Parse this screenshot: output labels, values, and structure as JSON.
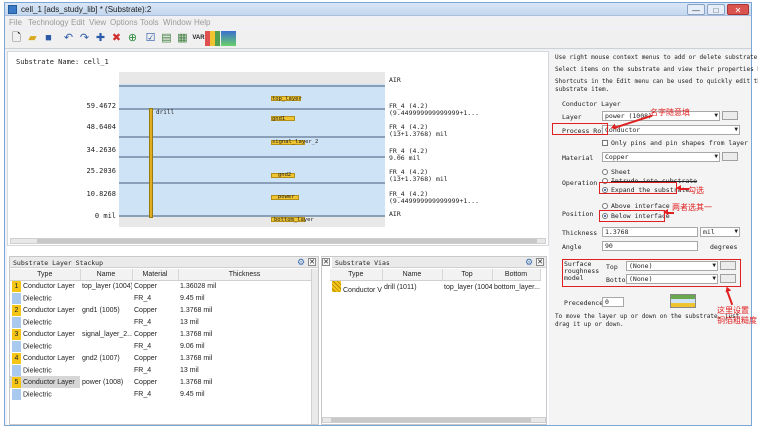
{
  "window": {
    "title": "cell_1 [ads_study_lib] * (Substrate):2",
    "controls": [
      "—",
      "□",
      "✕"
    ]
  },
  "menu": [
    "File",
    "Technology",
    "Edit",
    "View",
    "Options",
    "Tools",
    "Window",
    "Help"
  ],
  "toolbar": {
    "icons": [
      "new-icon",
      "open-icon",
      "save-icon",
      "undo-icon",
      "redo-icon",
      "insert-icon",
      "delete-icon",
      "zoom-icon",
      "check-icon",
      "table-icon",
      "table-icon",
      "var-icon",
      "layers-icon",
      "color-icon"
    ],
    "var_label": "VAR"
  },
  "substrate": {
    "name_label": "Substrate Name:",
    "name_value": "cell_1",
    "air_top": "AIR",
    "air_bottom": "AIR",
    "y_labels": [
      "59.4672",
      "48.6404",
      "34.2636",
      "25.2036",
      "10.8268",
      "0 mil"
    ],
    "right_labels": [
      "FR_4 (4.2)\n(9.449999999999999+1...",
      "FR_4 (4.2)\n(13+1.3768) mil",
      "FR_4 (4.2)\n9.06 mil",
      "FR_4 (4.2)\n(13+1.3768) mil",
      "FR_4 (4.2)\n(9.449999999999999+1..."
    ],
    "conductors": [
      "top_layer",
      "gnd1",
      "signal_layer_2",
      "gnd2",
      "power",
      "bottom_layer"
    ],
    "via_label": "drill"
  },
  "layer_stackup": {
    "title": "Substrate Layer Stackup",
    "columns": [
      "Type",
      "Name",
      "Material",
      "Thickness"
    ],
    "rows": [
      {
        "idx": "1",
        "type": "Conductor Layer",
        "name": "top_layer (1004)",
        "material": "Copper",
        "thickness": "1.36028 mil"
      },
      {
        "idx": "",
        "type": "Dielectric",
        "name": "",
        "material": "FR_4",
        "thickness": "9.45 mil"
      },
      {
        "idx": "2",
        "type": "Conductor Layer",
        "name": "gnd1 (1005)",
        "material": "Copper",
        "thickness": "1.3768 mil"
      },
      {
        "idx": "",
        "type": "Dielectric",
        "name": "",
        "material": "FR_4",
        "thickness": "13 mil"
      },
      {
        "idx": "3",
        "type": "Conductor Layer",
        "name": "signal_layer_2...",
        "material": "Copper",
        "thickness": "1.3768 mil"
      },
      {
        "idx": "",
        "type": "Dielectric",
        "name": "",
        "material": "FR_4",
        "thickness": "9.06 mil"
      },
      {
        "idx": "4",
        "type": "Conductor Layer",
        "name": "gnd2 (1007)",
        "material": "Copper",
        "thickness": "1.3768 mil"
      },
      {
        "idx": "",
        "type": "Dielectric",
        "name": "",
        "material": "FR_4",
        "thickness": "13 mil"
      },
      {
        "idx": "5",
        "type": "Conductor Layer",
        "name": "power (1008)",
        "material": "Copper",
        "thickness": "1.3768 mil"
      },
      {
        "idx": "",
        "type": "Dielectric",
        "name": "",
        "material": "FR_4",
        "thickness": "9.45 mil"
      }
    ]
  },
  "vias": {
    "title": "Substrate Vias",
    "columns": [
      "Type",
      "Name",
      "Top",
      "Bottom"
    ],
    "rows": [
      {
        "type": "Conductor Via",
        "name": "drill (1011)",
        "top": "top_layer (1004)",
        "bottom": "bottom_layer..."
      }
    ]
  },
  "properties": {
    "help": [
      "Use right mouse context menus to add or delete substrate items.",
      "Select items on the substrate and view their properties below.",
      "Shortcuts in the Edit menu can be used to quickly edit the next",
      "substrate item."
    ],
    "section": "Conductor Layer",
    "layer_label": "Layer",
    "layer_value": "power (1008)",
    "process_role_label": "Process Role",
    "process_role_value": "Conductor",
    "only_pins_label": "Only pins and pin shapes from layer",
    "material_label": "Material",
    "material_value": "Copper",
    "operation_label": "Operation",
    "op_sheet": "Sheet",
    "op_intrude": "Intrude into substrate",
    "op_expand": "Expand the substrate",
    "position_label": "Position",
    "pos_above": "Above interface",
    "pos_below": "Below interface",
    "thickness_label": "Thickness",
    "thickness_value": "1.3768",
    "thickness_unit": "mil",
    "angle_label": "Angle",
    "angle_value": "90",
    "angle_unit": "degrees",
    "roughness_label": "Surface roughness model",
    "rough_top_label": "Top",
    "rough_top_value": "(None)",
    "rough_bottom_label": "Bottom",
    "rough_bottom_value": "(None)",
    "precedence_label": "Precedence",
    "precedence_value": "0",
    "move_help": "To move the layer up or down on the substrate, just drag it up or down."
  },
  "annotations": {
    "name_note": "名字随意填",
    "expand_note": "勾选",
    "position_note": "两者选其一",
    "roughness_note_1": "这里设置",
    "roughness_note_2": "铜箔粗糙度"
  },
  "colors": {
    "annotation": "#e02020",
    "conductor": "#f0c430",
    "dielectric": "#cfe3f7"
  }
}
